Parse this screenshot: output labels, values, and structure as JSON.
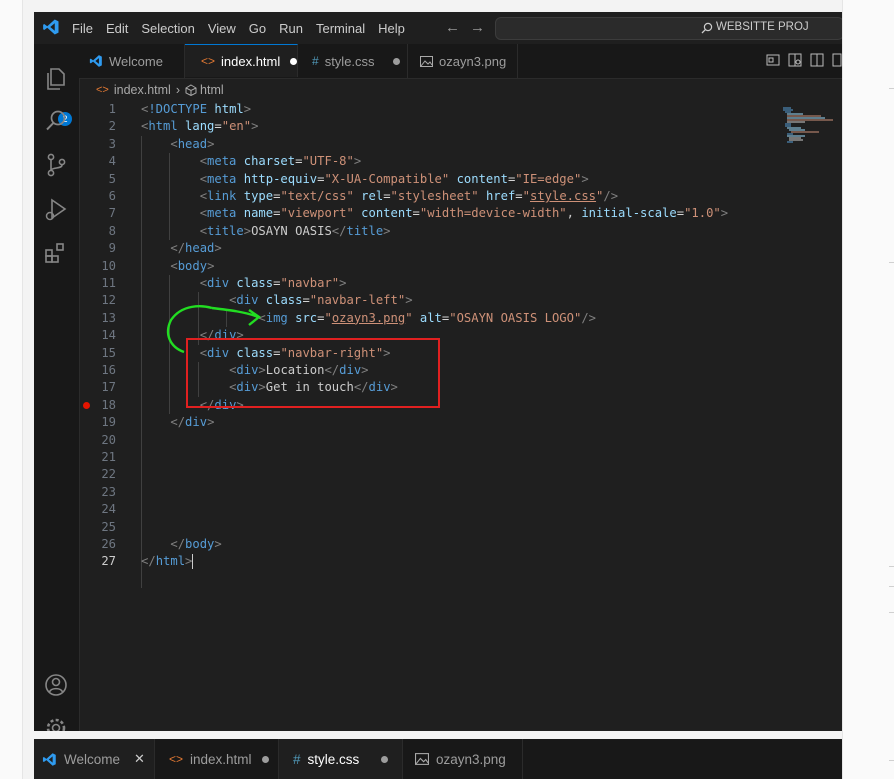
{
  "menu": [
    "File",
    "Edit",
    "Selection",
    "View",
    "Go",
    "Run",
    "Terminal",
    "Help"
  ],
  "search": {
    "text": "WEBSITTE PROJ"
  },
  "activity": {
    "badge": "2"
  },
  "tabs": [
    {
      "label": "Welcome",
      "icon": "vscode-icon"
    },
    {
      "label": "index.html",
      "icon": "html-icon",
      "modified": true
    },
    {
      "label": "style.css",
      "icon": "css-icon",
      "modified": true
    },
    {
      "label": "ozayn3.png",
      "icon": "image-icon"
    }
  ],
  "breadcrumb": {
    "file": "index.html",
    "element": "html"
  },
  "code_lines": [
    {
      "n": "1",
      "html": "<span class='p'>&lt;</span><span class='t'>!DOCTYPE</span> <span class='a'>html</span><span class='p'>&gt;</span>"
    },
    {
      "n": "2",
      "html": "<span class='p'>&lt;</span><span class='t'>html</span> <span class='a'>lang</span><span class='x'>=</span><span class='s'>\"en\"</span><span class='p'>&gt;</span>"
    },
    {
      "n": "3",
      "html": "    <span class='p'>&lt;</span><span class='t'>head</span><span class='p'>&gt;</span>"
    },
    {
      "n": "4",
      "html": "        <span class='p'>&lt;</span><span class='t'>meta</span> <span class='a'>charset</span><span class='x'>=</span><span class='s'>\"UTF-8\"</span><span class='p'>&gt;</span>"
    },
    {
      "n": "5",
      "html": "        <span class='p'>&lt;</span><span class='t'>meta</span> <span class='a'>http-equiv</span><span class='x'>=</span><span class='s'>\"X-UA-Compatible\"</span> <span class='a'>content</span><span class='x'>=</span><span class='s'>\"IE=edge\"</span><span class='p'>&gt;</span>"
    },
    {
      "n": "6",
      "html": "        <span class='p'>&lt;</span><span class='t'>link</span> <span class='a'>type</span><span class='x'>=</span><span class='s'>\"text/css\"</span> <span class='a'>rel</span><span class='x'>=</span><span class='s'>\"stylesheet\"</span> <span class='a'>href</span><span class='x'>=</span><span class='s'>\"<span class='s u'>style.css</span>\"</span><span class='p'>/&gt;</span>"
    },
    {
      "n": "7",
      "html": "        <span class='p'>&lt;</span><span class='t'>meta</span> <span class='a'>name</span><span class='x'>=</span><span class='s'>\"viewport\"</span> <span class='a'>content</span><span class='x'>=</span><span class='s'>\"width=device-width\"</span>, <span class='a'>initial-scale</span><span class='x'>=</span><span class='s'>\"1.0\"</span><span class='p'>&gt;</span>"
    },
    {
      "n": "8",
      "html": "        <span class='p'>&lt;</span><span class='t'>title</span><span class='p'>&gt;</span>OSAYN OASIS<span class='p'>&lt;/</span><span class='t'>title</span><span class='p'>&gt;</span>"
    },
    {
      "n": "9",
      "html": "    <span class='p'>&lt;/</span><span class='t'>head</span><span class='p'>&gt;</span>"
    },
    {
      "n": "10",
      "html": "    <span class='p'>&lt;</span><span class='t'>body</span><span class='p'>&gt;</span>"
    },
    {
      "n": "11",
      "html": "        <span class='p'>&lt;</span><span class='t'>div</span> <span class='a'>class</span><span class='x'>=</span><span class='s'>\"navbar\"</span><span class='p'>&gt;</span>"
    },
    {
      "n": "12",
      "html": "            <span class='p'>&lt;</span><span class='t'>div</span> <span class='a'>class</span><span class='x'>=</span><span class='s'>\"navbar-left\"</span><span class='p'>&gt;</span>"
    },
    {
      "n": "13",
      "html": "                <span class='p'>&lt;</span><span class='t'>img</span> <span class='a'>src</span><span class='x'>=</span><span class='s'>\"<span class='s u'>ozayn3.png</span>\"</span> <span class='a'>alt</span><span class='x'>=</span><span class='s'>\"OSAYN OASIS LOGO\"</span><span class='p'>/&gt;</span>"
    },
    {
      "n": "14",
      "html": "        <span class='p'>&lt;/</span><span class='t'>div</span><span class='p'>&gt;</span>"
    },
    {
      "n": "15",
      "html": "        <span class='p'>&lt;</span><span class='t'>div</span> <span class='a'>class</span><span class='x'>=</span><span class='s'>\"navbar-right\"</span><span class='p'>&gt;</span>"
    },
    {
      "n": "16",
      "html": "            <span class='p'>&lt;</span><span class='t'>div</span><span class='p'>&gt;</span>Location<span class='p'>&lt;/</span><span class='t'>div</span><span class='p'>&gt;</span>"
    },
    {
      "n": "17",
      "html": "            <span class='p'>&lt;</span><span class='t'>div</span><span class='p'>&gt;</span>Get in touch<span class='p'>&lt;/</span><span class='t'>div</span><span class='p'>&gt;</span>"
    },
    {
      "n": "18",
      "html": "        <span class='p'>&lt;/</span><span class='t'>div</span><span class='p'>&gt;</span>"
    },
    {
      "n": "19",
      "html": "    <span class='p'>&lt;/</span><span class='t'>div</span><span class='p'>&gt;</span>"
    },
    {
      "n": "20",
      "html": ""
    },
    {
      "n": "21",
      "html": ""
    },
    {
      "n": "22",
      "html": ""
    },
    {
      "n": "23",
      "html": ""
    },
    {
      "n": "24",
      "html": ""
    },
    {
      "n": "25",
      "html": ""
    },
    {
      "n": "26",
      "html": "    <span class='p'>&lt;/</span><span class='t'>body</span><span class='p'>&gt;</span>"
    },
    {
      "n": "27",
      "html": "<span class='p'>&lt;/</span><span class='t'>html</span><span class='p'>&gt;</span><span class='caret'></span>"
    }
  ],
  "current_line": "27",
  "breakpoint_line": "18",
  "colors": {
    "annotation_green": "#22dd22",
    "annotation_red": "#e02020",
    "accent": "#0078d4"
  },
  "bottom_tabs": [
    {
      "label": "Welcome",
      "icon": "vscode-icon",
      "closable": true
    },
    {
      "label": "index.html",
      "icon": "html-icon",
      "modified": true
    },
    {
      "label": "style.css",
      "icon": "css-icon",
      "modified": true
    },
    {
      "label": "ozayn3.png",
      "icon": "image-icon"
    }
  ]
}
